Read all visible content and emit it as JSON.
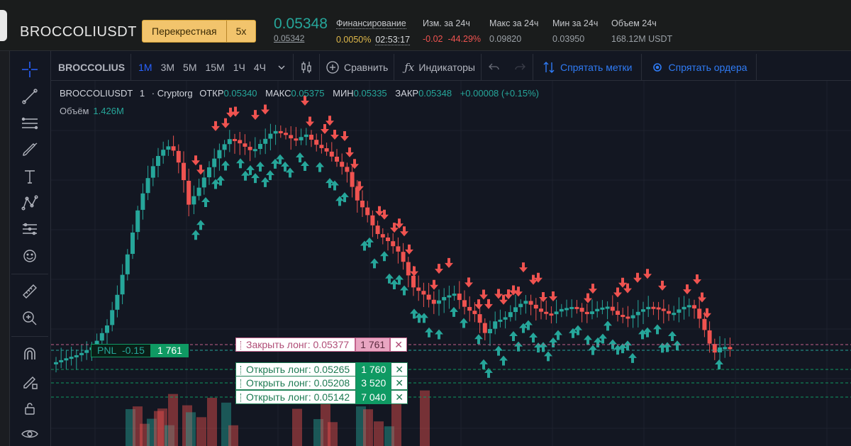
{
  "header": {
    "symbol": "BROCCOLIUSDT",
    "margin_mode": "Перекрестная",
    "leverage": "5x",
    "last_price": "0.05348",
    "mark_price": "0.05342",
    "funding": {
      "label": "Финансирование",
      "rate": "0.0050%",
      "countdown": "02:53:17"
    },
    "change_24h": {
      "label": "Изм. за 24ч",
      "value": "-0.02",
      "percent": "-44.29%"
    },
    "high_24h": {
      "label": "Макс за 24ч",
      "value": "0.09820"
    },
    "low_24h": {
      "label": "Мин за 24ч",
      "value": "0.03950"
    },
    "volume_24h": {
      "label": "Объем 24ч",
      "value": "168.12M USDT"
    }
  },
  "toolbar": {
    "symbol": "BROCCOLIUS",
    "intervals": [
      "1М",
      "3М",
      "5М",
      "15М",
      "1Ч",
      "4Ч"
    ],
    "active_interval": "1М",
    "compare": "Сравнить",
    "indicators": "Индикаторы",
    "hide_marks": "Спрятать метки",
    "hide_orders": "Спрятать ордера"
  },
  "left_tools": [
    "crosshair-icon",
    "trendline-icon",
    "fib-icon",
    "brush-icon",
    "text-icon",
    "pattern-icon",
    "forecast-icon",
    "emoji-icon",
    "ruler-icon",
    "zoom-in-icon",
    "magnet-icon",
    "lock-drawing-icon",
    "lock-icon",
    "eye-icon"
  ],
  "legend": {
    "symbol": "BROCCOLIUSDT",
    "interval": "1",
    "source": "Cryptorg",
    "open_label": "ОТКР",
    "open": "0.05340",
    "high_label": "МАКС",
    "high": "0.05375",
    "low_label": "МИН",
    "low": "0.05335",
    "close_label": "ЗАКР",
    "close": "0.05348",
    "change": "+0.00008 (+0.15%)",
    "volume_label": "Объём",
    "volume": "1.426M"
  },
  "position": {
    "pnl_label": "PNL",
    "pnl_value": "-0.15",
    "size": "1 761"
  },
  "orders": [
    {
      "type": "close",
      "label": "Закрыть лонг: 0.05377",
      "qty": "1 761",
      "price": 0.05377
    },
    {
      "type": "open",
      "label": "Открыть лонг: 0.05265",
      "qty": "1 760",
      "price": 0.05265
    },
    {
      "type": "open",
      "label": "Открыть лонг: 0.05208",
      "qty": "3 520",
      "price": 0.05208
    },
    {
      "type": "open",
      "label": "Открыть лонг: 0.05142",
      "qty": "7 040",
      "price": 0.05142
    }
  ],
  "colors": {
    "up": "#26a69a",
    "down": "#ef5350",
    "accent": "#2962ff",
    "background": "#131722"
  }
}
